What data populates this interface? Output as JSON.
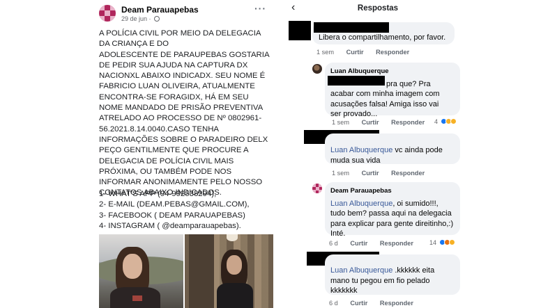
{
  "post": {
    "page_name": "Deam Parauapebas",
    "date": "29 de jun · ",
    "more": "···",
    "body": "A POLÍCIA CIVIL POR MEIO DA DELEGACIA DA CRIANÇA E DO\nADOLESCENTE DE PARAUPEBAS GOSTARIA DE PEDIR SUA AJUDA NA CAPTURA DX NACIONXL ABAIXO INDICADX. SEU NOME É FABRICIO LUAN OLIVEIRA, ATUALMENTE ENCONTRA-SE FORAGIDX, HÁ EM SEU NOME MANDADO DE PRISÃO PREVENTIVA ATRELADO AO PROCESSO DE Nº 0802961-56.2021.8.14.0040.CASO TENHA INFORMAÇÕES SOBRE O PARADEIRO DELX PEÇO GENTILMENTE QUE PROCURE A DELEGACIA DE POLÍCIA CIVIL MAIS PRÓXIMA, OU TAMBÉM PODE NOS INFORMAR ANONIMAMENTE PELO NOSSO CONTATOS ABAIXO INDICADOS.",
    "contacts": [
      "1- WHAT'S APP (94-992538294),",
      "2- E-MAIL (DEAM.PEBAS@GMAIL.COM),",
      "3- FACEBOOK ( DEAM PARAUAPEBAS)",
      "4- INSTAGRAM ( @deamparauapebas)."
    ]
  },
  "replies": {
    "back": "‹",
    "title": "Respostas",
    "comments": [
      {
        "text": "Libera o compartilhamento, por favor.",
        "time": "1 sem",
        "like": "Curtir",
        "reply": "Responder"
      },
      {
        "author": "Luan Albuquerque",
        "text": "pra que? Pra acabar com minha imagem com acusações falsa! Amiga isso vai ser provado...",
        "time": "1 sem",
        "like": "Curtir",
        "reply": "Responder",
        "reactions": "4"
      },
      {
        "mention": "Luan Albuquerque",
        "text": " vc ainda pode muda sua vida",
        "time": "1 sem",
        "like": "Curtir",
        "reply": "Responder"
      },
      {
        "author": "Deam Parauapebas",
        "mention": "Luan Albuquerque",
        "text": ", oi sumido!!!, tudo bem? passa aqui na delegacia para explicar para gente direitinho,:) Inté.",
        "time": "6 d",
        "like": "Curtir",
        "reply": "Responder",
        "reactions": "14"
      },
      {
        "mention": "Luan Albuquerque",
        "text": " .kkkkkk eita mano tu pegou em fio pelado kkkkkkk",
        "time": "6 d",
        "like": "Curtir",
        "reply": "Responder"
      }
    ],
    "reaction_colors": {
      "like": "#1877f2",
      "haha": "#f7b125",
      "angry": "#e9710f"
    }
  }
}
